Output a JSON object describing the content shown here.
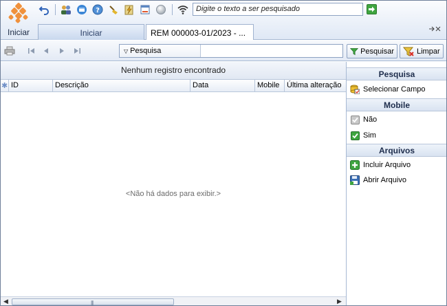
{
  "toolbar": {
    "home_label": "Iniciar",
    "search_placeholder": "Digite o texto a ser pesquisado"
  },
  "tabs": [
    {
      "label": "Iniciar"
    },
    {
      "label": "REM 000003-01/2023 - ..."
    }
  ],
  "grid_toolbar": {
    "filter_label": "Pesquisa",
    "filter_value": "",
    "search_button": "Pesquisar",
    "clear_button": "Limpar"
  },
  "grid": {
    "status": "Nenhum registro encontrado",
    "columns": [
      "ID",
      "Descrição",
      "Data",
      "Mobile",
      "Última alteração"
    ],
    "empty_message": "<Não há dados para exibir.>"
  },
  "side_panel": {
    "sections": [
      {
        "title": "Pesquisa",
        "items": [
          {
            "label": "Selecionar Campo",
            "icon": "select-field-icon"
          }
        ]
      },
      {
        "title": "Mobile",
        "items": [
          {
            "label": "Não",
            "icon": "checkbox-gray-icon"
          },
          {
            "label": "Sim",
            "icon": "checkbox-green-icon"
          }
        ]
      },
      {
        "title": "Arquivos",
        "items": [
          {
            "label": "Incluir Arquivo",
            "icon": "add-green-icon"
          },
          {
            "label": "Abrir Arquivo",
            "icon": "floppy-icon"
          }
        ]
      }
    ]
  },
  "colors": {
    "accent_orange": "#f0913c",
    "header_blue": "#d9e3f1",
    "green": "#3fa540"
  }
}
